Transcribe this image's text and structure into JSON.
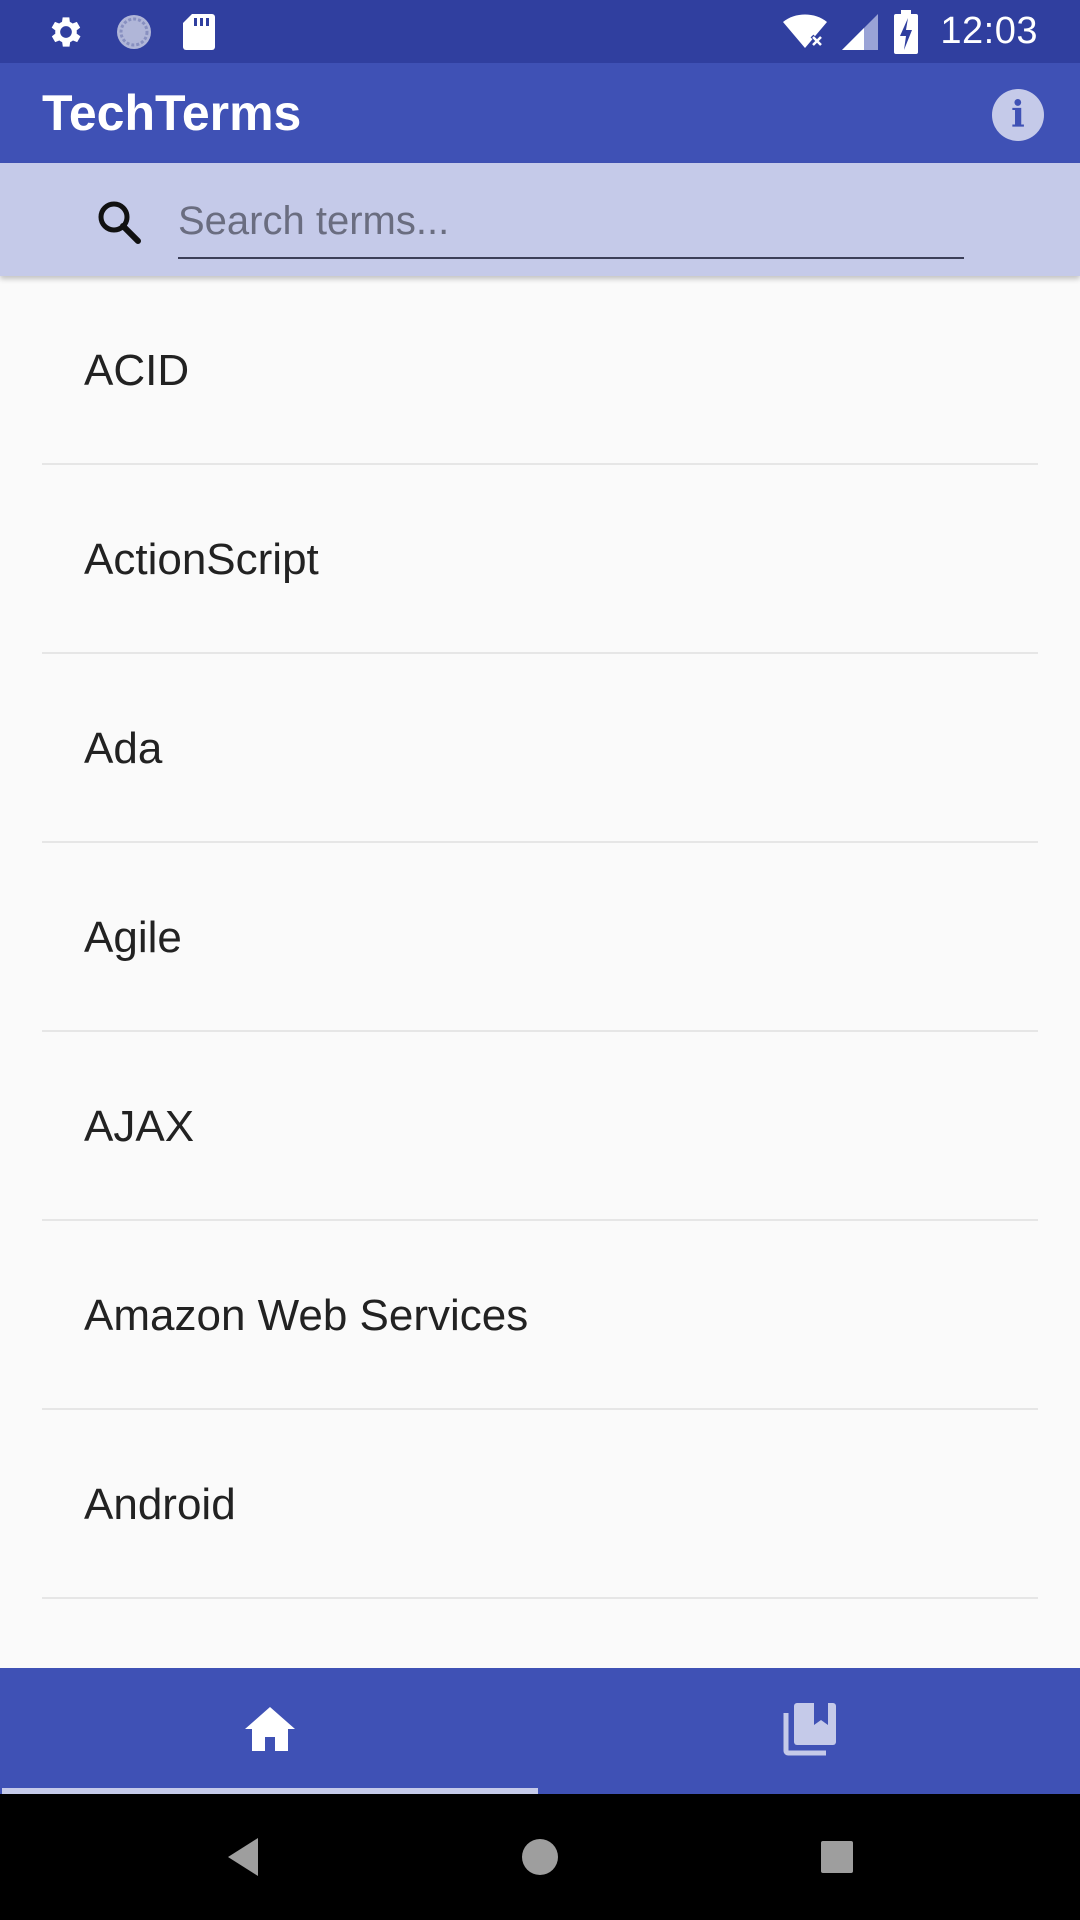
{
  "status_bar": {
    "time": "12:03",
    "left_icons": [
      "settings-icon",
      "sync-icon",
      "sd-card-icon"
    ],
    "right_icons": [
      "wifi-icon",
      "signal-icon",
      "battery-charging-icon"
    ]
  },
  "app_bar": {
    "title": "TechTerms",
    "info_icon": "info-icon",
    "info_glyph": "i"
  },
  "search": {
    "placeholder": "Search terms...",
    "value": "",
    "icon": "search-icon"
  },
  "terms": [
    "ACID",
    "ActionScript",
    "Ada",
    "Agile",
    "AJAX",
    "Amazon Web Services",
    "Android"
  ],
  "bottom_nav": {
    "tabs": [
      {
        "icon": "home-icon",
        "active": true
      },
      {
        "icon": "bookmarks-icon",
        "active": false
      }
    ]
  },
  "system_nav": [
    "back-icon",
    "home-circle-icon",
    "recents-icon"
  ],
  "colors": {
    "primary": "#3f51b5",
    "primary_dark": "#303f9f",
    "primary_light": "#c5cae9",
    "background": "#fafafa"
  }
}
